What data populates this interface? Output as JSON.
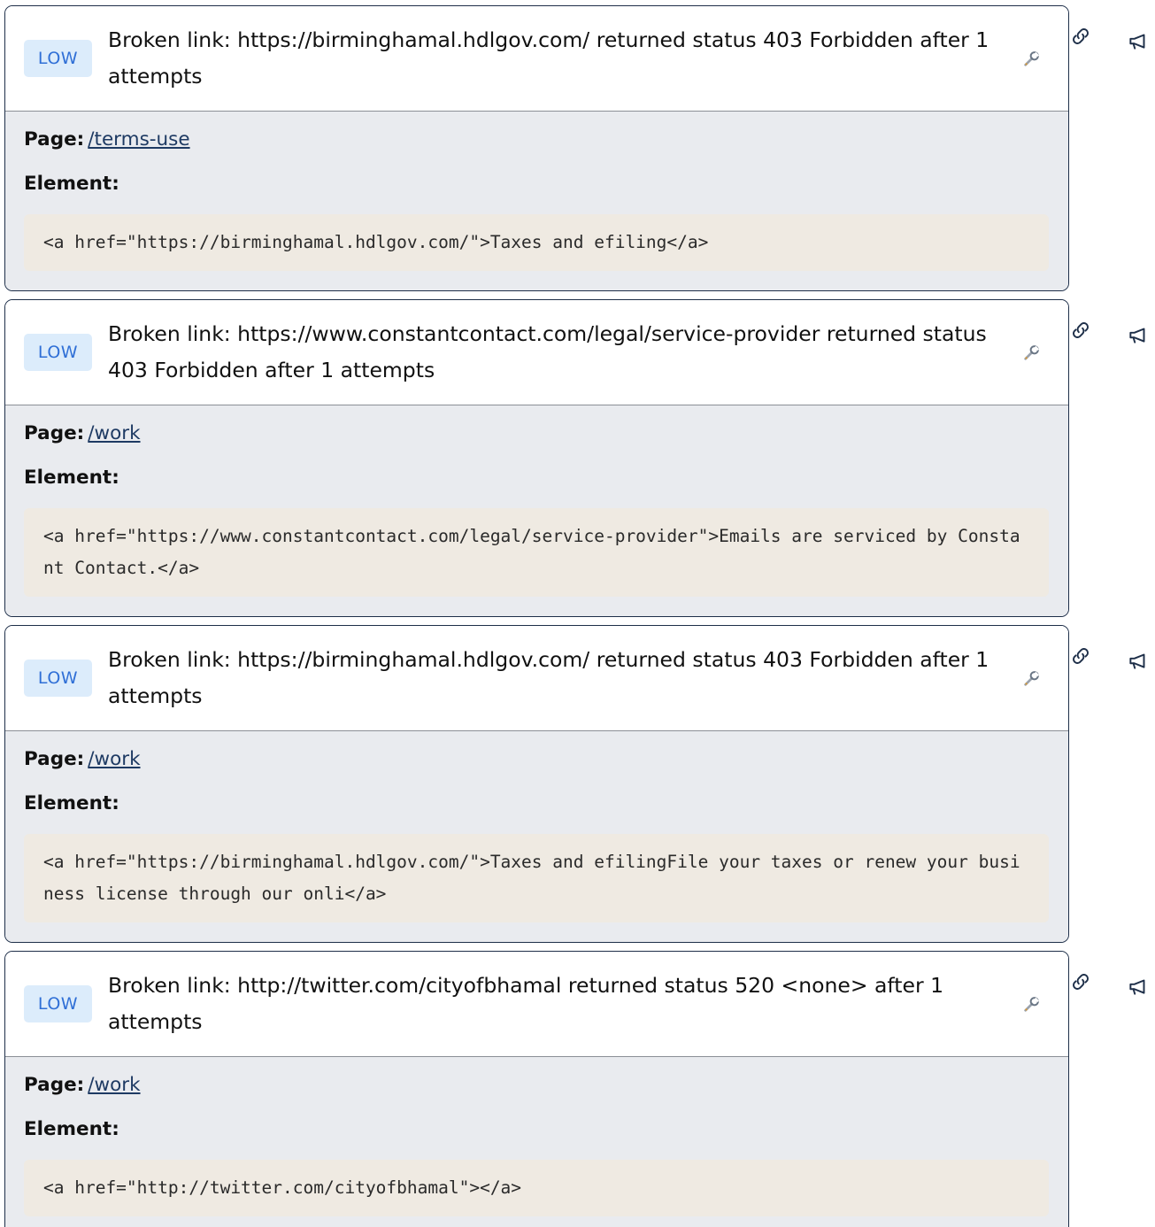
{
  "issues": [
    {
      "severity": "LOW",
      "title": "Broken link: https://birminghamal.hdlgov.com/ returned status 403 Forbidden after 1 attempts",
      "page_label": "Page:",
      "page": "/terms-use",
      "element_label": "Element:",
      "code": "<a href=\"https://birminghamal.hdlgov.com/\">Taxes and efiling</a>"
    },
    {
      "severity": "LOW",
      "title": "Broken link: https://www.constantcontact.com/legal/service-provider returned status 403 Forbidden after 1 attempts",
      "page_label": "Page:",
      "page": "/work",
      "element_label": "Element:",
      "code": "<a href=\"https://www.constantcontact.com/legal/service-provider\">Emails are serviced by Constant Contact.</a>"
    },
    {
      "severity": "LOW",
      "title": "Broken link: https://birminghamal.hdlgov.com/ returned status 403 Forbidden after 1 attempts",
      "page_label": "Page:",
      "page": "/work",
      "element_label": "Element:",
      "code": "<a href=\"https://birminghamal.hdlgov.com/\">Taxes and efilingFile your taxes or renew your business license through our onli</a>"
    },
    {
      "severity": "LOW",
      "title": "Broken link: http://twitter.com/cityofbhamal returned status 520 <none> after 1 attempts",
      "page_label": "Page:",
      "page": "/work",
      "element_label": "Element:",
      "code": "<a href=\"http://twitter.com/cityofbhamal\"></a>"
    }
  ],
  "icons": {
    "fix": "wrench-icon",
    "copy_link": "link-icon",
    "report": "megaphone-icon"
  },
  "colors": {
    "border": "#1e2f49",
    "badge_bg": "#dcecfb",
    "badge_text": "#2f6fd6",
    "body_bg": "#e9ebef",
    "code_bg": "#efeae2",
    "link": "#1e3a63"
  }
}
